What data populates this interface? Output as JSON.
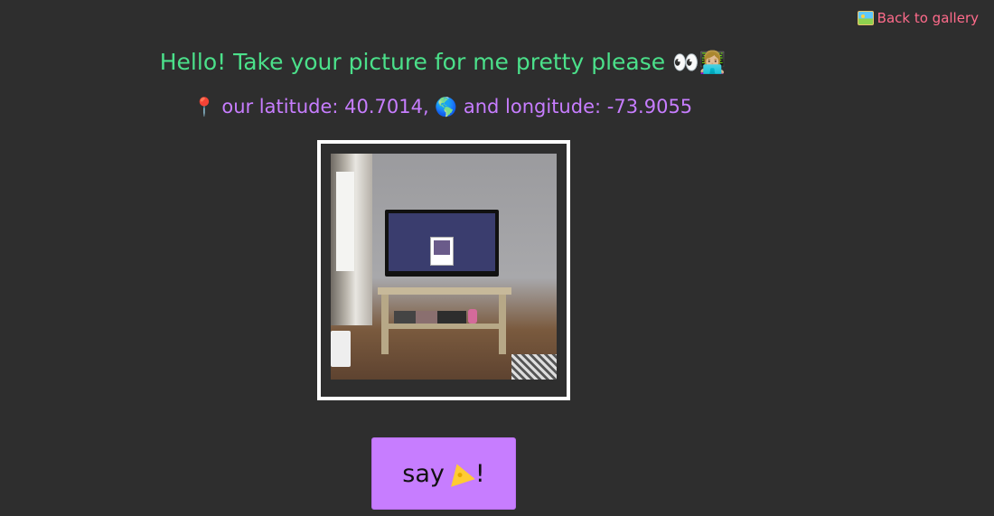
{
  "back_link": {
    "icon": "framed-picture-icon",
    "label": "Back to gallery"
  },
  "headline": {
    "text": "Hello! Take your picture for me pretty please",
    "emoji": "👀👩🏼‍💻"
  },
  "location": {
    "pin_emoji": "📍",
    "latitude_label": "our latitude: ",
    "latitude_value": "40.7014,",
    "globe_emoji": "🌎",
    "longitude_label": "and longitude: ",
    "longitude_value": "-73.9055"
  },
  "camera": {
    "preview_alt": "camera preview"
  },
  "button": {
    "say": "say ",
    "icon": "cheese-icon",
    "suffix": "!"
  },
  "colors": {
    "background": "#2e2e2e",
    "headline": "#4be08a",
    "coords": "#c77dff",
    "link": "#ff6b8b",
    "button": "#c77dff"
  }
}
